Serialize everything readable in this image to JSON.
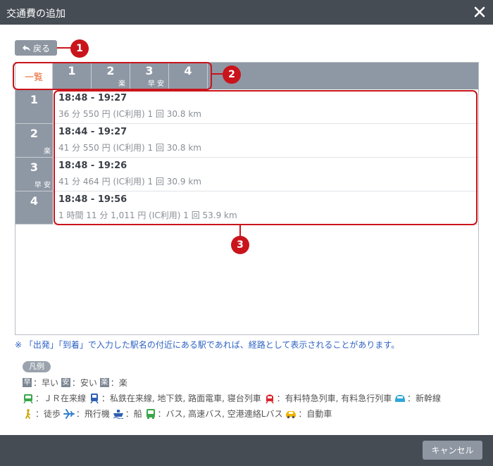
{
  "window": {
    "title": "交通費の追加"
  },
  "back_label": "戻る",
  "callouts": [
    "1",
    "2",
    "3"
  ],
  "tabs": [
    {
      "label": "一覧"
    },
    {
      "label": "1",
      "badges": ""
    },
    {
      "label": "2",
      "badges": "楽"
    },
    {
      "label": "3",
      "badges": "早 安"
    },
    {
      "label": "4",
      "badges": ""
    }
  ],
  "routes": [
    {
      "num": "1",
      "badges": "",
      "time": "18:48 - 19:27",
      "detail": "36 分 550 円 (IC利用) 1 回 30.8 km"
    },
    {
      "num": "2",
      "badges": "楽",
      "time": "18:44 - 19:27",
      "detail": "41 分 550 円 (IC利用) 1 回 30.8 km"
    },
    {
      "num": "3",
      "badges": "早 安",
      "time": "18:48 - 19:26",
      "detail": "41 分 464 円 (IC利用) 1 回 30.9 km"
    },
    {
      "num": "4",
      "badges": "",
      "time": "18:48 - 19:56",
      "detail": "1 時間 11 分 1,011 円 (IC利用) 1 回 53.9 km"
    }
  ],
  "note": "※ 「出発」「到着」で入力した駅名の付近にある駅であれば、経路として表示されることがあります。",
  "legend": {
    "title": "凡例",
    "row1": [
      {
        "badge": "早",
        "text": "：早い"
      },
      {
        "badge": "安",
        "text": "：安い"
      },
      {
        "badge": "楽",
        "text": "：楽"
      }
    ],
    "row2": [
      {
        "icon": "train-icon",
        "color": "#3aa64a",
        "text": "：ＪＲ在来線"
      },
      {
        "icon": "private-railway-icon",
        "color": "#2f5fb3",
        "text": "：私鉄在来線, 地下鉄, 路面電車, 寝台列車"
      },
      {
        "icon": "limited-express-icon",
        "color": "#d9262e",
        "text": "：有料特急列車, 有料急行列車"
      },
      {
        "icon": "shinkansen-icon",
        "color": "#2fa6d9",
        "text": "：新幹線"
      }
    ],
    "row3": [
      {
        "icon": "walk-icon",
        "color": "#c8a400",
        "text": "：徒歩"
      },
      {
        "icon": "airplane-icon",
        "color": "#2f7fd0",
        "text": "：飛行機"
      },
      {
        "icon": "ship-icon",
        "color": "#2f5fb3",
        "text": "：船"
      },
      {
        "icon": "bus-icon",
        "color": "#3aa64a",
        "text": "：バス, 高速バス, 空港連絡Lバス"
      },
      {
        "icon": "car-icon",
        "color": "#f0b400",
        "text": "：自動車"
      }
    ]
  },
  "cancel_label": "キャンセル"
}
